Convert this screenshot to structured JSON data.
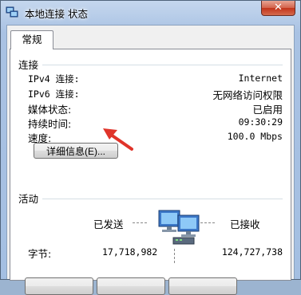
{
  "window": {
    "title": "本地连接 状态",
    "close_label": "✕"
  },
  "tabs": [
    {
      "label": "常规"
    }
  ],
  "connection": {
    "section_title": "连接",
    "rows": [
      {
        "label": "IPv4 连接:",
        "value": "Internet"
      },
      {
        "label": "IPv6 连接:",
        "value": "无网络访问权限"
      },
      {
        "label": "媒体状态:",
        "value": "已启用"
      },
      {
        "label": "持续时间:",
        "value": "09:30:29"
      },
      {
        "label": "速度:",
        "value": "100.0 Mbps"
      }
    ],
    "details_button": "详细信息(E)..."
  },
  "activity": {
    "section_title": "活动",
    "sent_label": "已发送",
    "received_label": "已接收",
    "bytes_label": "字节:",
    "bytes_sent": "17,718,982",
    "bytes_received": "124,727,738"
  },
  "icons": {
    "network": "network-computers-icon",
    "annotation": "red-arrow-annotation"
  },
  "colors": {
    "arrow": "#e0342a",
    "title_bar": "#a9c2e3"
  }
}
